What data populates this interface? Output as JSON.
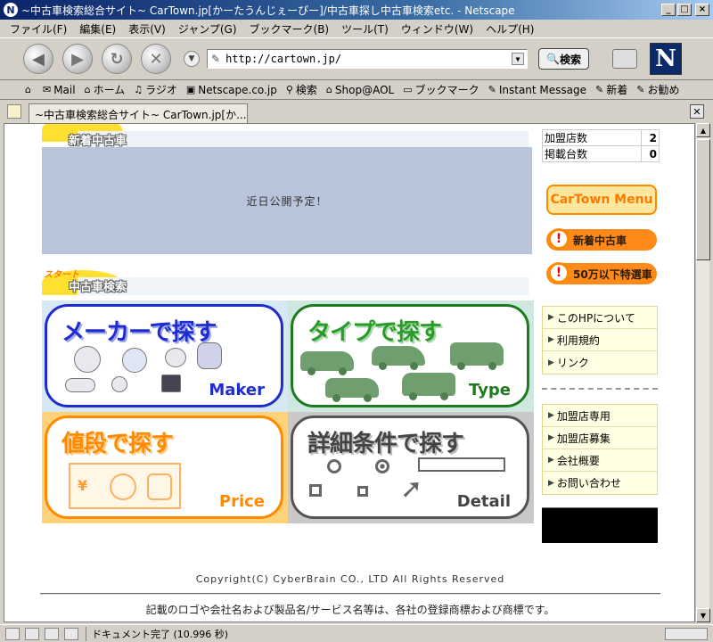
{
  "window": {
    "title": "~中古車検索総合サイト~ CarTown.jp[かーたうんじぇーぴー]/中古車探し中古車検索etc. - Netscape",
    "app_icon": "N",
    "minimize": "_",
    "maximize": "□",
    "close": "×"
  },
  "menubar": [
    "ファイル(F)",
    "編集(E)",
    "表示(V)",
    "ジャンプ(G)",
    "ブックマーク(B)",
    "ツール(T)",
    "ウィンドウ(W)",
    "ヘルプ(H)"
  ],
  "navbar": {
    "url": "http://cartown.jp/",
    "search_label": "検索",
    "logo": "N"
  },
  "personal_toolbar": [
    "Mail",
    "ホーム",
    "ラジオ",
    "Netscape.co.jp",
    "検索",
    "Shop@AOL",
    "ブックマーク",
    "Instant Message",
    "新着",
    "お勧め"
  ],
  "tab": {
    "label": "~中古車検索総合サイト~ CarTown.jp[か..."
  },
  "page": {
    "new_cars_heading": "新着中古車",
    "coming_soon": "近日公開予定！",
    "search_start": "スタート",
    "search_heading": "中古車検索",
    "search_boxes": {
      "maker": {
        "title": "メーカーで探す",
        "en": "Maker"
      },
      "type": {
        "title": "タイプで探す",
        "en": "Type"
      },
      "price": {
        "title": "値段で探す",
        "en": "Price"
      },
      "detail": {
        "title": "詳細条件で探す",
        "en": "Detail"
      }
    },
    "stats": [
      {
        "label": "加盟店数",
        "value": "2"
      },
      {
        "label": "掲載台数",
        "value": "0"
      }
    ],
    "cartown_menu": "CarTown Menu",
    "new_cars_btn": "新着中古車",
    "under50_btn": "50万以下特選車",
    "links1": [
      "このHPについて",
      "利用規約",
      "リンク"
    ],
    "links2": [
      "加盟店専用",
      "加盟店募集",
      "会社概要",
      "お問い合わせ"
    ],
    "copyright": "Copyright(C) CyberBrain CO., LTD All Rights Reserved",
    "trademark": "記載のロゴや会社名および製品名/サービス名等は、各社の登録商標および商標です。"
  },
  "statusbar": {
    "text": "ドキュメント完了 (10.996 秒)"
  },
  "colors": {
    "maker": "#1f2dd0",
    "type": "#1e7a1e",
    "price": "#ff8a00",
    "detail": "#555555"
  }
}
